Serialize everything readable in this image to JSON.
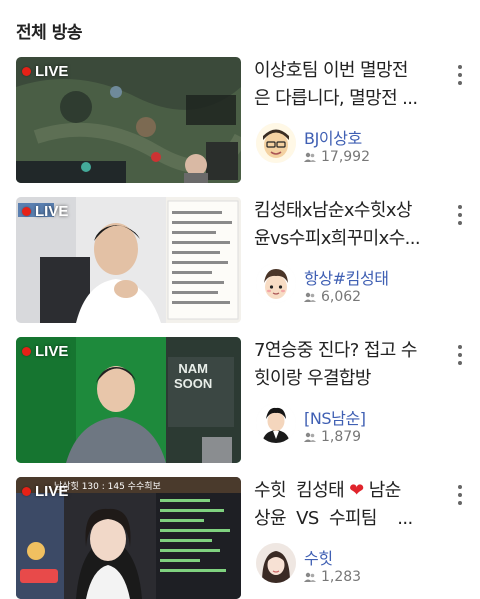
{
  "section": {
    "title": "전체 방송"
  },
  "live_label": "LIVE",
  "broadcasts": [
    {
      "title_lines": [
        "이상호팀 이번 멸망전",
        "은 다릅니다, 멸망전 ..."
      ],
      "channel": "BJ이상호",
      "viewers": "17,992",
      "thumb_theme": "game"
    },
    {
      "title_lines": [
        "킴성태x남순x수힛x상",
        "윤vs수피x희꾸미x수..."
      ],
      "channel": "항상#킴성태",
      "viewers": "6,062",
      "thumb_theme": "room"
    },
    {
      "title_lines": [
        "7연승중 진다? 접고 수",
        "힛이랑 우결합방"
      ],
      "channel": "[NS남순]",
      "viewers": "1,879",
      "thumb_theme": "green",
      "overlay_text": [
        "NAM",
        "SOON"
      ]
    },
    {
      "title_lines_html": true,
      "title_line1_a": "수힛  킴성태",
      "title_line1_b": "남순",
      "title_line2": "상윤  VS  수피팀    ...",
      "channel": "수힛",
      "viewers": "1,283",
      "thumb_theme": "stream",
      "overlay_text": [
        "남삼힛 130 : 145 수수희보"
      ]
    }
  ],
  "colors": {
    "channel_name": "#3f5fb3",
    "live_dot": "#e62117",
    "heart": "#e0242c"
  }
}
